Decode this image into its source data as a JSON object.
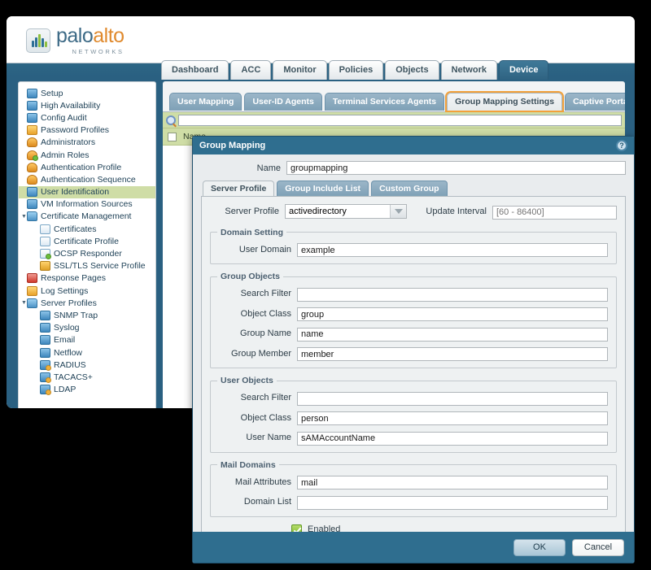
{
  "brand": {
    "name_primary": "palo",
    "name_secondary": "alto",
    "tagline": "NETWORKS",
    "logo_icon": "bar-chart-logo-icon"
  },
  "topnav": {
    "tabs": [
      {
        "label": "Dashboard",
        "active": false
      },
      {
        "label": "ACC",
        "active": false
      },
      {
        "label": "Monitor",
        "active": false
      },
      {
        "label": "Policies",
        "active": false
      },
      {
        "label": "Objects",
        "active": false
      },
      {
        "label": "Network",
        "active": false
      },
      {
        "label": "Device",
        "active": true
      }
    ]
  },
  "sidebar": {
    "items": [
      {
        "label": "Setup",
        "icon": "setup-icon",
        "level": 1,
        "selected": false,
        "expander": ""
      },
      {
        "label": "High Availability",
        "icon": "high-availability-icon",
        "level": 1,
        "selected": false,
        "expander": ""
      },
      {
        "label": "Config Audit",
        "icon": "config-audit-icon",
        "level": 1,
        "selected": false,
        "expander": ""
      },
      {
        "label": "Password Profiles",
        "icon": "key-icon",
        "level": 1,
        "selected": false,
        "expander": ""
      },
      {
        "label": "Administrators",
        "icon": "user-icon",
        "level": 1,
        "selected": false,
        "expander": ""
      },
      {
        "label": "Admin Roles",
        "icon": "user-check-icon",
        "level": 1,
        "selected": false,
        "expander": ""
      },
      {
        "label": "Authentication Profile",
        "icon": "users-icon",
        "level": 1,
        "selected": false,
        "expander": ""
      },
      {
        "label": "Authentication Sequence",
        "icon": "users-sequence-icon",
        "level": 1,
        "selected": false,
        "expander": ""
      },
      {
        "label": "User Identification",
        "icon": "user-id-icon",
        "level": 1,
        "selected": true,
        "expander": ""
      },
      {
        "label": "VM Information Sources",
        "icon": "vm-icon",
        "level": 1,
        "selected": false,
        "expander": ""
      },
      {
        "label": "Certificate Management",
        "icon": "certificate-folder-icon",
        "level": 1,
        "selected": false,
        "expander": "▼"
      },
      {
        "label": "Certificates",
        "icon": "certificate-icon",
        "level": 2,
        "selected": false,
        "expander": ""
      },
      {
        "label": "Certificate Profile",
        "icon": "certificate-icon",
        "level": 2,
        "selected": false,
        "expander": ""
      },
      {
        "label": "OCSP Responder",
        "icon": "ocsp-responder-icon",
        "level": 2,
        "selected": false,
        "expander": ""
      },
      {
        "label": "SSL/TLS Service Profile",
        "icon": "lock-icon",
        "level": 2,
        "selected": false,
        "expander": ""
      },
      {
        "label": "Response Pages",
        "icon": "response-pages-icon",
        "level": 1,
        "selected": false,
        "expander": ""
      },
      {
        "label": "Log Settings",
        "icon": "log-settings-icon",
        "level": 1,
        "selected": false,
        "expander": ""
      },
      {
        "label": "Server Profiles",
        "icon": "server-profiles-folder-icon",
        "level": 1,
        "selected": false,
        "expander": "▼"
      },
      {
        "label": "SNMP Trap",
        "icon": "server-icon",
        "level": 2,
        "selected": false,
        "expander": ""
      },
      {
        "label": "Syslog",
        "icon": "server-icon",
        "level": 2,
        "selected": false,
        "expander": ""
      },
      {
        "label": "Email",
        "icon": "server-icon",
        "level": 2,
        "selected": false,
        "expander": ""
      },
      {
        "label": "Netflow",
        "icon": "server-icon",
        "level": 2,
        "selected": false,
        "expander": ""
      },
      {
        "label": "RADIUS",
        "icon": "server-lock-icon",
        "level": 2,
        "selected": false,
        "expander": ""
      },
      {
        "label": "TACACS+",
        "icon": "server-lock-icon",
        "level": 2,
        "selected": false,
        "expander": ""
      },
      {
        "label": "LDAP",
        "icon": "server-lock-icon",
        "level": 2,
        "selected": false,
        "expander": ""
      }
    ]
  },
  "content": {
    "tabs": [
      {
        "label": "User Mapping",
        "active": false
      },
      {
        "label": "User-ID Agents",
        "active": false
      },
      {
        "label": "Terminal Services Agents",
        "active": false
      },
      {
        "label": "Group Mapping Settings",
        "active": true
      },
      {
        "label": "Captive Portal Settings",
        "active": false
      }
    ],
    "search": {
      "value": "",
      "placeholder": "",
      "icon": "search-icon"
    },
    "table": {
      "columns": [
        "Name"
      ]
    }
  },
  "dialog": {
    "title": "Group Mapping",
    "help_icon": "help-icon",
    "help_glyph": "?",
    "name_label": "Name",
    "name_value": "groupmapping",
    "tabs": [
      {
        "label": "Server Profile",
        "active": true
      },
      {
        "label": "Group Include List",
        "active": false
      },
      {
        "label": "Custom Group",
        "active": false
      }
    ],
    "server_profile": {
      "server_profile_label": "Server Profile",
      "server_profile_value": "activedirectory",
      "update_interval_label": "Update Interval",
      "update_interval_value": "",
      "update_interval_placeholder": "[60 - 86400]"
    },
    "domain_setting": {
      "legend": "Domain Setting",
      "fields": [
        {
          "label": "User Domain",
          "value": "example",
          "placeholder": ""
        }
      ]
    },
    "group_objects": {
      "legend": "Group Objects",
      "fields": [
        {
          "label": "Search Filter",
          "value": "",
          "placeholder": ""
        },
        {
          "label": "Object Class",
          "value": "group",
          "placeholder": ""
        },
        {
          "label": "Group Name",
          "value": "name",
          "placeholder": ""
        },
        {
          "label": "Group Member",
          "value": "member",
          "placeholder": ""
        }
      ]
    },
    "user_objects": {
      "legend": "User Objects",
      "fields": [
        {
          "label": "Search Filter",
          "value": "",
          "placeholder": ""
        },
        {
          "label": "Object Class",
          "value": "person",
          "placeholder": ""
        },
        {
          "label": "User Name",
          "value": "sAMAccountName",
          "placeholder": ""
        }
      ]
    },
    "mail_domains": {
      "legend": "Mail Domains",
      "fields": [
        {
          "label": "Mail Attributes",
          "value": "mail",
          "placeholder": ""
        },
        {
          "label": "Domain List",
          "value": "",
          "placeholder": ""
        }
      ]
    },
    "enabled": {
      "label": "Enabled",
      "checked": true
    },
    "buttons": {
      "ok": "OK",
      "cancel": "Cancel"
    }
  },
  "colors": {
    "brand_blue": "#3d6a86",
    "brand_orange": "#e08a2e",
    "nav_active": "#2f6382",
    "dialog_header": "#2f6e8f",
    "highlight_green": "#cfdda6",
    "tab_highlight_orange": "#f2a13a",
    "checkbox_green": "#7fbb2c"
  }
}
